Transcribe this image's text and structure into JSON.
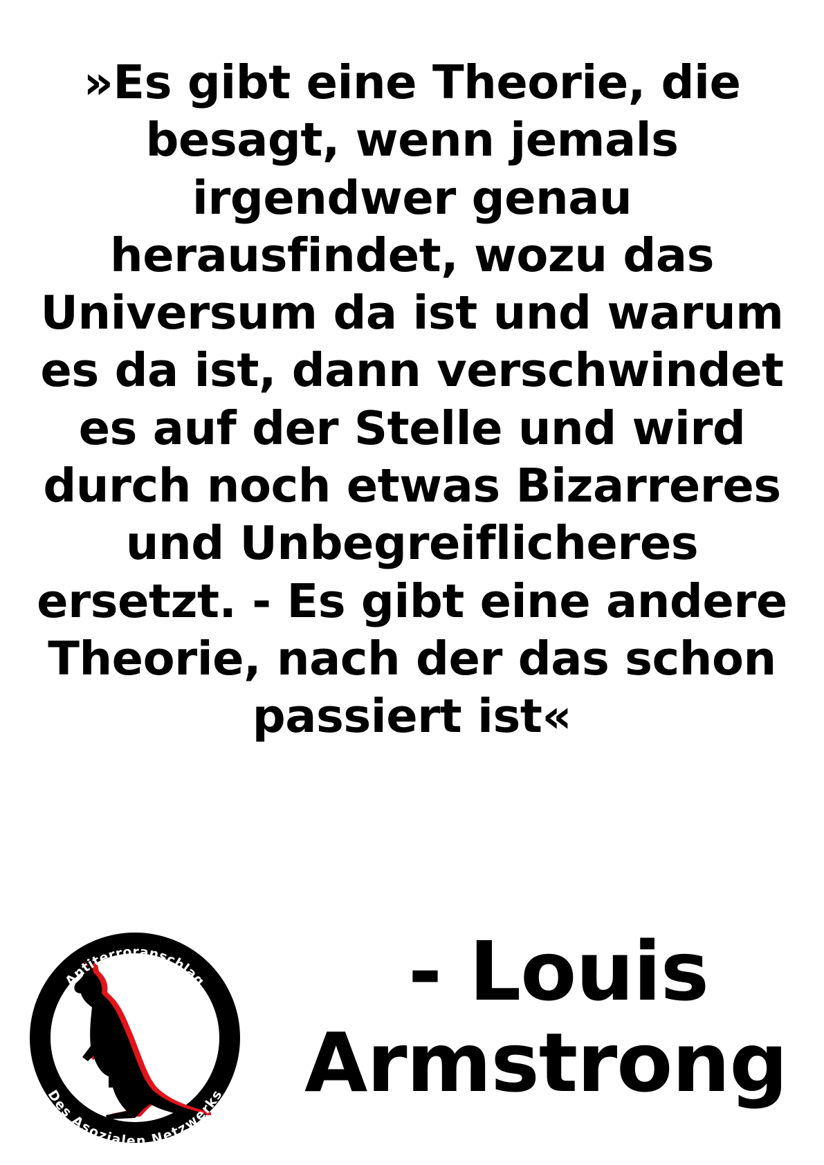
{
  "quote": {
    "lines": [
      "»Es gibt eine Theorie, die",
      "besagt, wenn jemals",
      "irgendwer genau",
      "herausfindet, wozu das",
      "Universum da ist und warum",
      "es da ist, dann verschwindet",
      "es auf der Stelle und wird",
      "durch noch etwas Bizarreres",
      "und Unbegreiflicheres",
      "ersetzt. - Es gibt eine andere",
      "Theorie, nach der das schon",
      "passiert ist«"
    ]
  },
  "attribution": {
    "line1": "- Louis",
    "line2": "Armstrong"
  },
  "logo": {
    "top_text": "Antiterroranschlag",
    "bottom_text": "Des Asozialen Netzwerks",
    "icon": "kangaroo-icon",
    "colors": {
      "ring": "#000000",
      "kangaroo": "#000000",
      "shadow": "#e0141b",
      "text": "#ffffff"
    }
  }
}
